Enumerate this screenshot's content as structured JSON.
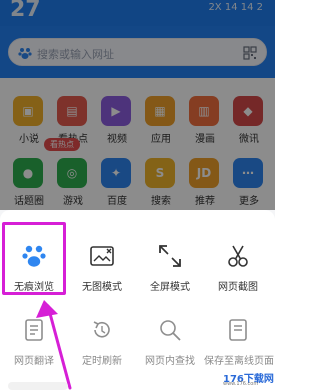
{
  "status": {
    "temperature": "27",
    "weather_text": "2X 14 14 2"
  },
  "search": {
    "placeholder": "搜索或输入网址"
  },
  "apps": [
    {
      "label": "小说",
      "color": "#f2b12a",
      "icon": "book-icon"
    },
    {
      "label": "看热点",
      "color": "#e65b4f",
      "icon": "hot-icon"
    },
    {
      "label": "视频",
      "color": "#8d5de0",
      "icon": "play-icon"
    },
    {
      "label": "应用",
      "color": "#f0a12a",
      "icon": "app-icon"
    },
    {
      "label": "漫画",
      "color": "#f36f3e",
      "icon": "comic-icon"
    },
    {
      "label": "微讯",
      "color": "#d64a4a",
      "icon": "news-icon"
    },
    {
      "label": "话题圈",
      "color": "#2fb04f",
      "icon": "topic-icon"
    },
    {
      "label": "游戏",
      "color": "#2fb04f",
      "icon": "game-icon"
    },
    {
      "label": "百度",
      "color": "#2f86f0",
      "icon": "baidu-icon"
    },
    {
      "label": "搜索",
      "color": "#f0b52a",
      "icon": "search-icon"
    },
    {
      "label": "推荐",
      "color": "#f0a12a",
      "icon": "recommend-icon"
    },
    {
      "label": "更多",
      "color": "#2f86f0",
      "icon": "more-icon"
    }
  ],
  "badge": {
    "text": "看热点"
  },
  "menu": {
    "row1": [
      {
        "label": "无痕浏览",
        "icon": "incognito-paw-icon"
      },
      {
        "label": "无图模式",
        "icon": "no-image-icon"
      },
      {
        "label": "全屏模式",
        "icon": "fullscreen-icon"
      },
      {
        "label": "网页截图",
        "icon": "scissors-icon"
      }
    ],
    "row2": [
      {
        "label": "网页翻译",
        "icon": "translate-icon"
      },
      {
        "label": "定时刷新",
        "icon": "refresh-icon"
      },
      {
        "label": "网页内查找",
        "icon": "find-in-page-icon"
      },
      {
        "label": "保存至离线页面",
        "icon": "save-offline-icon"
      }
    ]
  },
  "watermark": {
    "text": "176下载网",
    "sub": "www.176.com"
  }
}
